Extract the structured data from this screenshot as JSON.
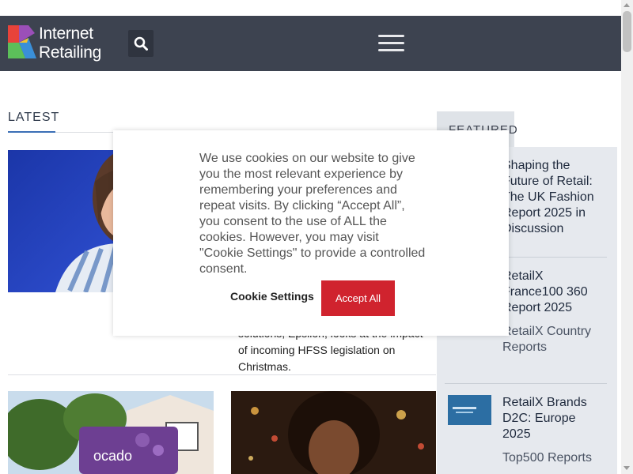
{
  "header": {
    "logo_line1": "Internet",
    "logo_line2": "Retailing",
    "logo_colors": [
      "#e8433a",
      "#5cbf5a",
      "#3a8fd8",
      "#f2c230",
      "#9b4fb8"
    ],
    "search_icon": "search-icon",
    "menu_icon": "hamburger-menu-icon"
  },
  "latest": {
    "section_title": "LATEST",
    "card_excerpt": "solutions, Epsilon, looks at the impact of incoming HFSS legislation on Christmas."
  },
  "featured": {
    "section_title": "FEATURED",
    "items": [
      {
        "title": "Shaping the Future of Retail: The UK Fashion Report 2025 in Discussion",
        "category": ""
      },
      {
        "title": "RetailX France100 360 Report 2025",
        "category": "RetailX Country Reports"
      },
      {
        "title": "RetailX Brands D2C: Europe 2025",
        "category": "Top500 Reports"
      }
    ]
  },
  "cookie_banner": {
    "message": "We use cookies on our website to give you the most relevant experience by remembering your preferences and repeat visits. By clicking “Accept All”, you consent to the use of ALL the cookies. However, you may visit \"Cookie Settings\" to provide a controlled consent.",
    "settings_label": "Cookie Settings",
    "accept_label": "Accept All",
    "accept_color": "#d0232e"
  },
  "colors": {
    "header_bg": "#3d4350",
    "accent_blue": "#3b6fb6",
    "featured_bg": "#e6e9ee"
  }
}
